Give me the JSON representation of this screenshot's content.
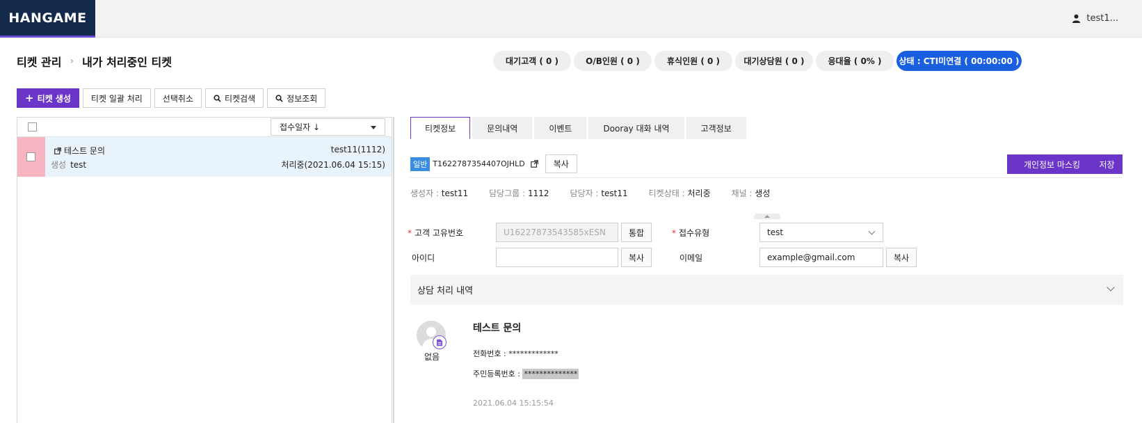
{
  "header": {
    "logo": "HANGAME",
    "user_name": "test1..."
  },
  "breadcrumb": {
    "root": "티켓 관리",
    "current": "내가 처리중인 티켓"
  },
  "status_pills": [
    "대기고객 ( 0 )",
    "O/B인원 ( 0 )",
    "휴식인원 ( 0 )",
    "대기상담원 ( 0 )",
    "응대율 ( 0% )",
    "상태 : CTI미연결 ( 00:00:00 )"
  ],
  "toolbar": {
    "create": "티켓 생성",
    "batch": "티켓 일괄 처리",
    "deselect": "선택취소",
    "search": "티켓검색",
    "info": "정보조회"
  },
  "list": {
    "sort_label": "접수일자 ↓",
    "ticket": {
      "title": "테스트 문의",
      "channel": "생성",
      "creator": "test",
      "owner": "test11(1112)",
      "status": "처리중(2021.06.04 15:15)"
    }
  },
  "tabs": [
    "티켓정보",
    "문의내역",
    "이벤트",
    "Dooray 대화 내역",
    "고객정보"
  ],
  "ticket_info": {
    "type_tag": "일반",
    "ticket_id": "T1622787354407OJHLD",
    "copy": "복사",
    "mask_button": "개인정보 마스킹",
    "save_button": "저장",
    "meta": [
      {
        "k": "생성자 : ",
        "v": "test11"
      },
      {
        "k": "담당그룹 : ",
        "v": "1112"
      },
      {
        "k": "담당자 : ",
        "v": "test11"
      },
      {
        "k": "티켓상태 : ",
        "v": "처리중"
      },
      {
        "k": "채널 : ",
        "v": "생성"
      }
    ]
  },
  "form": {
    "customer_id_label": "고객 고유번호",
    "customer_id_value": "U16227873543585xESN",
    "merge_button": "통합",
    "reception_type_label": "접수유형",
    "reception_type_value": "test",
    "account_label": "아이디",
    "account_value": "",
    "copy_button": "복사",
    "email_label": "이메일",
    "email_value": "example@gmail.com"
  },
  "history": {
    "section_title": "상담 처리 내역",
    "avatar_label": "없음",
    "title": "테스트 문의",
    "phone_label": "전화번호 : ",
    "phone_value": "*************",
    "rrn_label": "주민등록번호 : ",
    "rrn_value": "**************",
    "timestamp": "2021.06.04 15:15:54"
  },
  "colors": {
    "brand": "#6a35c8",
    "cti": "#1a5fe0",
    "logo_bg": "#142a4a",
    "row_marker": "#f6b5c0"
  }
}
